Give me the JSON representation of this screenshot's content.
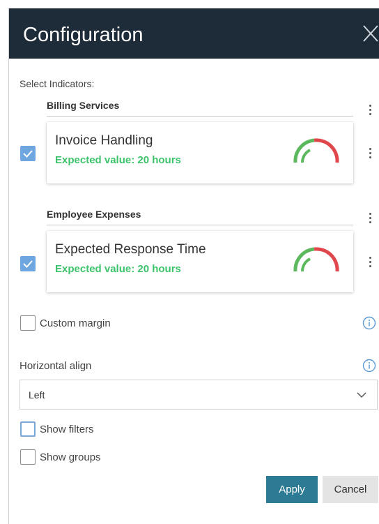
{
  "dialog": {
    "title": "Configuration",
    "close_icon": "close-icon"
  },
  "indicators": {
    "label": "Select Indicators:",
    "groups": [
      {
        "name": "Billing Services",
        "card": {
          "title": "Invoice Handling",
          "subtitle": "Expected value: 20 hours",
          "checked": true,
          "gauge_icon": "gauge-icon"
        }
      },
      {
        "name": "Employee Expenses",
        "card": {
          "title": "Expected Response Time",
          "subtitle": "Expected value: 20 hours",
          "checked": true,
          "gauge_icon": "gauge-icon"
        }
      }
    ]
  },
  "options": {
    "custom_margin": {
      "label": "Custom margin",
      "checked": false
    },
    "horizontal_align": {
      "label": "Horizontal align",
      "selected": "Left"
    },
    "show_filters": {
      "label": "Show filters",
      "checked": false
    },
    "show_groups": {
      "label": "Show groups",
      "checked": false
    }
  },
  "actions": {
    "apply_label": "Apply",
    "cancel_label": "Cancel"
  },
  "colors": {
    "header_bg": "#1e2b38",
    "accent_green": "#3cc36b",
    "checkbox_blue": "#6ea6e0",
    "apply_bg": "#2d7a94",
    "gauge_red": "#e0474c",
    "gauge_green": "#5cb85c"
  }
}
